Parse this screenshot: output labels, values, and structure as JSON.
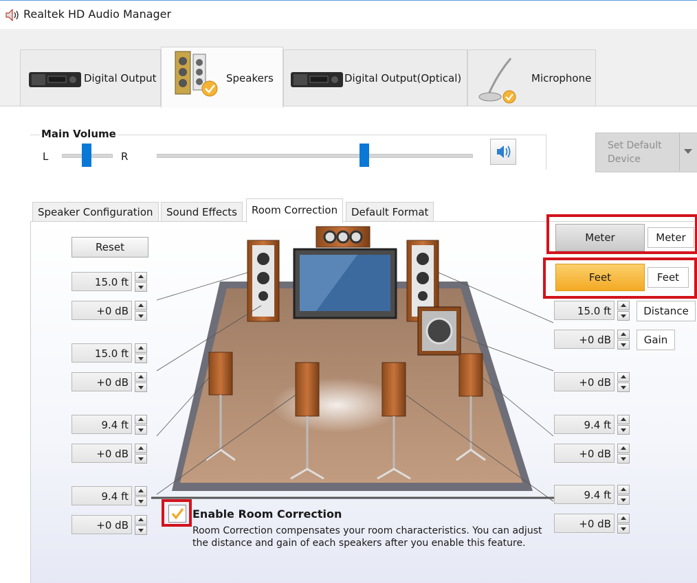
{
  "window": {
    "title": "Realtek HD Audio Manager",
    "icon": "speaker-icon"
  },
  "device_tabs": [
    {
      "label": "Digital Output",
      "icon": "digital-output-device-icon",
      "active": false
    },
    {
      "label": "Speakers",
      "icon": "speakers-device-icon",
      "active": true
    },
    {
      "label": "Digital Output(Optical)",
      "icon": "optical-output-device-icon",
      "active": false
    },
    {
      "label": "Microphone",
      "icon": "microphone-device-icon",
      "active": false
    }
  ],
  "main_volume": {
    "title": "Main Volume",
    "balance_left": "L",
    "balance_right": "R",
    "balance_level": 0.5,
    "volume_level": 0.66,
    "mute_icon": "speaker-volume-icon"
  },
  "set_default": {
    "label": "Set Default Device",
    "line1": "Set Default",
    "line2": "Device"
  },
  "inner_tabs": [
    "Speaker Configuration",
    "Sound Effects",
    "Room Correction",
    "Default Format"
  ],
  "active_inner_tab": "Room Correction",
  "room_correction": {
    "reset_label": "Reset",
    "left_controls": [
      {
        "distance": "15.0 ft",
        "gain": "+0 dB"
      },
      {
        "distance": "15.0 ft",
        "gain": "+0 dB"
      },
      {
        "distance": "9.4 ft",
        "gain": "+0 dB"
      },
      {
        "distance": "9.4 ft",
        "gain": "+0 dB"
      }
    ],
    "right_controls": {
      "top": {
        "distance": "15.0 ft",
        "gain": "+0 dB"
      },
      "sub": {
        "gain": "+0 dB"
      },
      "mid": {
        "distance": "9.4 ft",
        "gain": "+0 dB"
      },
      "bottom": {
        "distance": "9.4 ft",
        "gain": "+0 dB"
      }
    },
    "unit_meter_button": "Meter",
    "unit_meter_label": "Meter",
    "unit_feet_button": "Feet",
    "unit_feet_label": "Feet",
    "distance_label": "Distance",
    "gain_label": "Gain",
    "enable_checked": true,
    "enable_title": "Enable Room Correction",
    "enable_description": "Room Correction compensates your room characteristics. You can adjust the distance and gain of each speakers after you enable this feature."
  },
  "colors": {
    "accent_blue": "#0a78d7",
    "feet_active": "#f5b437",
    "highlight_red": "#d2131c",
    "floor": "#b08b6e",
    "wood": "#b9652c"
  }
}
